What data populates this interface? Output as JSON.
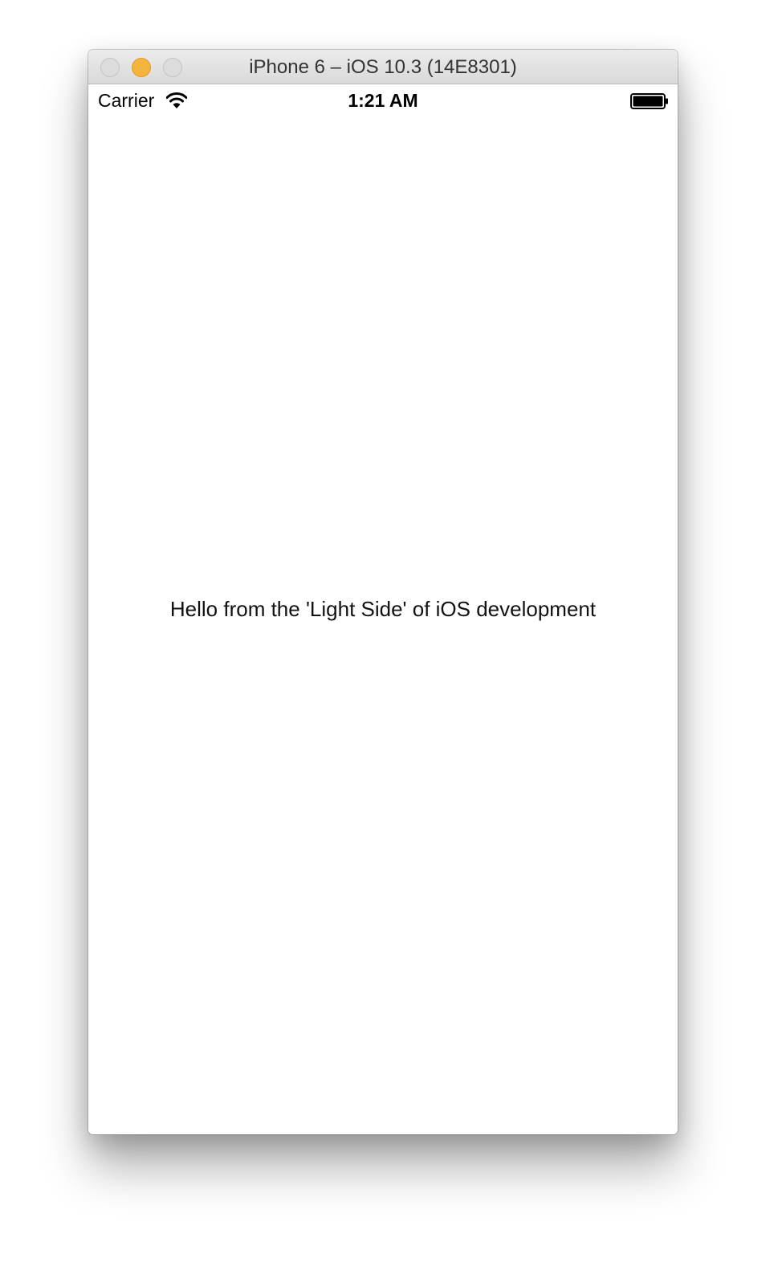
{
  "window": {
    "title": "iPhone 6 – iOS 10.3 (14E8301)"
  },
  "status_bar": {
    "carrier": "Carrier",
    "time": "1:21 AM",
    "wifi_icon": "wifi-icon",
    "battery_icon": "battery-icon"
  },
  "main": {
    "label": "Hello from the 'Light Side' of iOS development"
  },
  "colors": {
    "minimize_button": "#f5b43c",
    "inactive_buttons": "#dcdcdc",
    "titlebar": "#e2e2e2"
  }
}
